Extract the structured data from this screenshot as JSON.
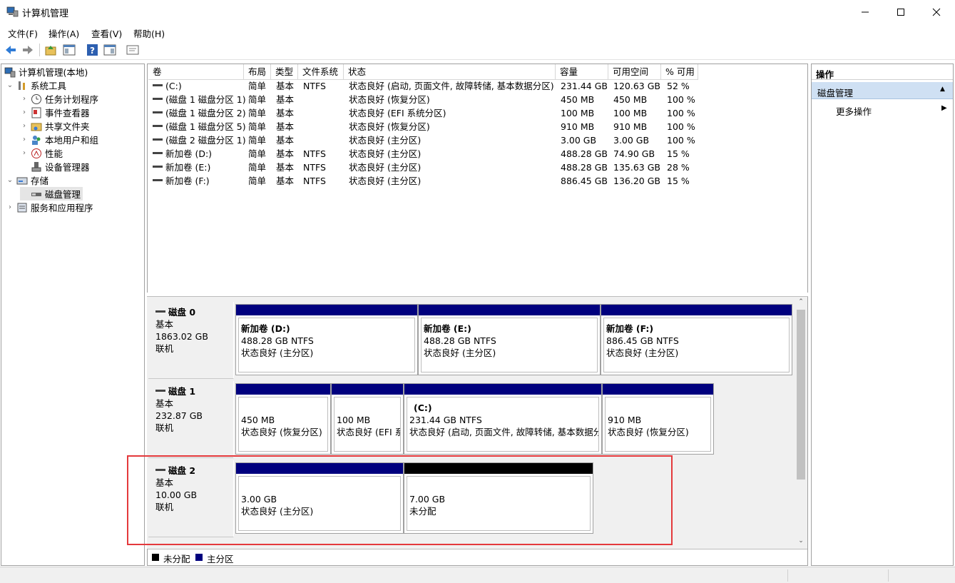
{
  "window": {
    "title": "计算机管理"
  },
  "menu": [
    "文件(F)",
    "操作(A)",
    "查看(V)",
    "帮助(H)"
  ],
  "tree": {
    "root": "计算机管理(本地)",
    "system_tools": "系统工具",
    "task_scheduler": "任务计划程序",
    "event_viewer": "事件查看器",
    "shared_folders": "共享文件夹",
    "local_users": "本地用户和组",
    "performance": "性能",
    "device_manager": "设备管理器",
    "storage": "存储",
    "disk_management": "磁盘管理",
    "services_apps": "服务和应用程序"
  },
  "volume_table": {
    "columns": [
      "卷",
      "布局",
      "类型",
      "文件系统",
      "状态",
      "容量",
      "可用空间",
      "% 可用"
    ],
    "rows": [
      [
        "(C:)",
        "简单",
        "基本",
        "NTFS",
        "状态良好 (启动, 页面文件, 故障转储, 基本数据分区)",
        "231.44 GB",
        "120.63 GB",
        "52 %"
      ],
      [
        "(磁盘 1 磁盘分区 1)",
        "简单",
        "基本",
        "",
        "状态良好 (恢复分区)",
        "450 MB",
        "450 MB",
        "100 %"
      ],
      [
        "(磁盘 1 磁盘分区 2)",
        "简单",
        "基本",
        "",
        "状态良好 (EFI 系统分区)",
        "100 MB",
        "100 MB",
        "100 %"
      ],
      [
        "(磁盘 1 磁盘分区 5)",
        "简单",
        "基本",
        "",
        "状态良好 (恢复分区)",
        "910 MB",
        "910 MB",
        "100 %"
      ],
      [
        "(磁盘 2 磁盘分区 1)",
        "简单",
        "基本",
        "",
        "状态良好 (主分区)",
        "3.00 GB",
        "3.00 GB",
        "100 %"
      ],
      [
        "新加卷 (D:)",
        "简单",
        "基本",
        "NTFS",
        "状态良好 (主分区)",
        "488.28 GB",
        "74.90 GB",
        "15 %"
      ],
      [
        "新加卷 (E:)",
        "简单",
        "基本",
        "NTFS",
        "状态良好 (主分区)",
        "488.28 GB",
        "135.63 GB",
        "28 %"
      ],
      [
        "新加卷 (F:)",
        "简单",
        "基本",
        "NTFS",
        "状态良好 (主分区)",
        "886.45 GB",
        "136.20 GB",
        "15 %"
      ]
    ]
  },
  "disks": [
    {
      "name": "磁盘 0",
      "type": "基本",
      "size": "1863.02 GB",
      "state": "联机",
      "partitions": [
        {
          "name": "新加卷  (D:)",
          "size": "488.28 GB NTFS",
          "status": "状态良好 (主分区)"
        },
        {
          "name": "新加卷  (E:)",
          "size": "488.28 GB NTFS",
          "status": "状态良好 (主分区)"
        },
        {
          "name": "新加卷  (F:)",
          "size": "886.45 GB NTFS",
          "status": "状态良好 (主分区)"
        }
      ]
    },
    {
      "name": "磁盘 1",
      "type": "基本",
      "size": "232.87 GB",
      "state": "联机",
      "partitions": [
        {
          "name": "",
          "size": "450 MB",
          "status": "状态良好 (恢复分区)"
        },
        {
          "name": "",
          "size": "100 MB",
          "status": "状态良好 (EFI 系"
        },
        {
          "name": "(C:)",
          "size": "231.44 GB NTFS",
          "status": "状态良好 (启动, 页面文件, 故障转储, 基本数据分"
        },
        {
          "name": "",
          "size": "910 MB",
          "status": "状态良好 (恢复分区)"
        }
      ]
    },
    {
      "name": "磁盘 2",
      "type": "基本",
      "size": "10.00 GB",
      "state": "联机",
      "partitions": [
        {
          "name": "",
          "size": "3.00 GB",
          "status": "状态良好 (主分区)"
        },
        {
          "name": "",
          "size": "7.00 GB",
          "status": "未分配"
        }
      ]
    }
  ],
  "legend": {
    "unallocated": "未分配",
    "primary": "主分区"
  },
  "actions": {
    "header": "操作",
    "section": "磁盘管理",
    "more": "更多操作"
  },
  "colors": {
    "primary_partition": "#00007e",
    "unallocated": "#000000",
    "highlight": "#e4393c",
    "selection": "#cfe0f3"
  }
}
